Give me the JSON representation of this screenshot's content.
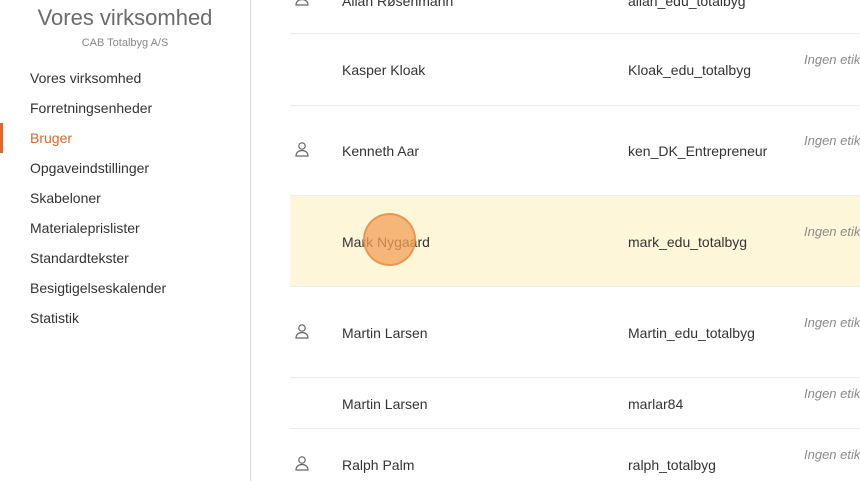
{
  "sidebar": {
    "org_name": "Vores virksomhed",
    "org_subtitle": "CAB Totalbyg A/S",
    "items": [
      {
        "label": "Vores virksomhed"
      },
      {
        "label": "Forretningsenheder"
      },
      {
        "label": "Bruger",
        "active": true
      },
      {
        "label": "Opgaveindstillinger"
      },
      {
        "label": "Skabeloner"
      },
      {
        "label": "Materialeprislister"
      },
      {
        "label": "Standardtekster"
      },
      {
        "label": "Besigtigelseskalender"
      },
      {
        "label": "Statistik"
      }
    ]
  },
  "users": {
    "rows": [
      {
        "name": "Allan Røsenmann",
        "username": "allan_edu_totalbyg",
        "tag": "",
        "icon": "user-icon"
      },
      {
        "name": "Kasper Kloak",
        "username": "Kloak_edu_totalbyg",
        "tag": "Ingen etik",
        "icon": ""
      },
      {
        "name": "Kenneth Aar",
        "username": "ken_DK_Entrepreneur",
        "tag": "Ingen etik",
        "icon": "user-icon"
      },
      {
        "name": "Mark Nygaard",
        "username": "mark_edu_totalbyg",
        "tag": "Ingen etik",
        "icon": "",
        "highlighted": true
      },
      {
        "name": "Martin Larsen",
        "username": "Martin_edu_totalbyg",
        "tag": "Ingen etik",
        "icon": "user-icon"
      },
      {
        "name": "Martin Larsen",
        "username": "marlar84",
        "tag": "Ingen etik",
        "icon": ""
      },
      {
        "name": "Ralph Palm",
        "username": "ralph_totalbyg",
        "tag": "Ingen etik",
        "icon": "user-icon"
      }
    ]
  },
  "colors": {
    "accent": "#e0662c",
    "highlight_row": "#fdf6d8",
    "click_marker": "#f4a05a"
  }
}
